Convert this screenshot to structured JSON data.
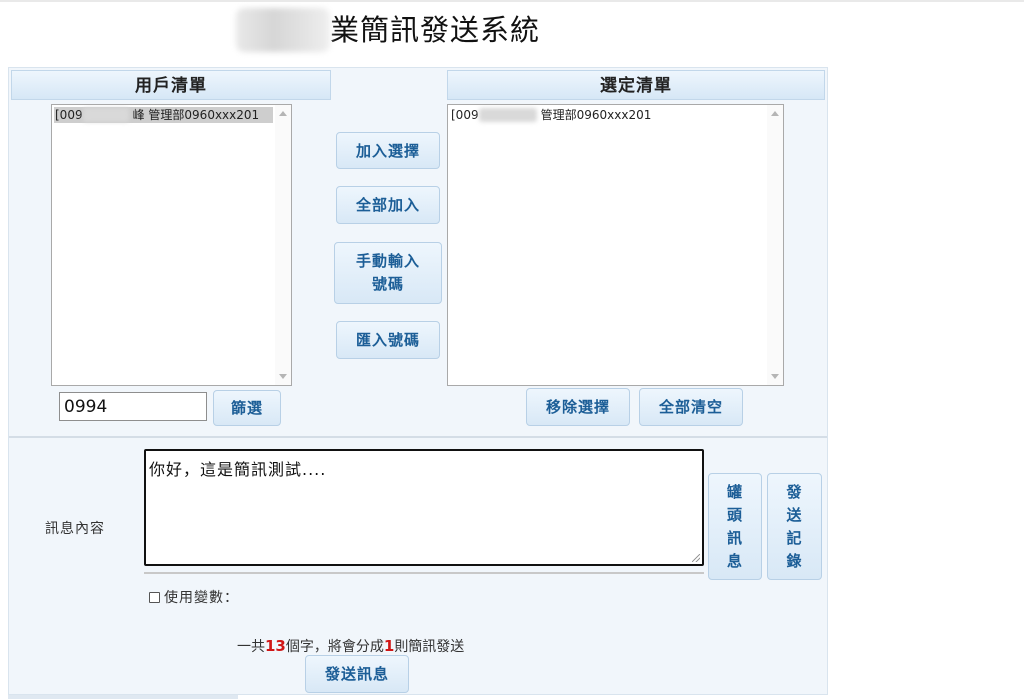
{
  "page": {
    "title_suffix": "業簡訊發送系統"
  },
  "left_list": {
    "header": "用戶清單",
    "items": [
      {
        "prefix": "[009",
        "suffix": "峰 管理部0960xxx201",
        "selected": true
      }
    ],
    "filter_value": "0994",
    "filter_button": "篩選"
  },
  "middle_buttons": {
    "add_selected": "加入選擇",
    "add_all": "全部加入",
    "manual_line1": "手動輸入",
    "manual_line2": "號碼",
    "import": "匯入號碼"
  },
  "right_list": {
    "header": "選定清單",
    "items": [
      {
        "prefix": "[009",
        "suffix": "管理部0960xxx201"
      }
    ],
    "remove_button": "移除選擇",
    "clear_button": "全部清空"
  },
  "message": {
    "label": "訊息內容",
    "content": "你好，這是簡訊測試....",
    "use_variables_label": "使用變數：",
    "use_variables_checked": false,
    "canned_button": [
      "罐",
      "頭",
      "訊",
      "息"
    ],
    "history_button": [
      "發",
      "送",
      "記",
      "錄"
    ],
    "count": {
      "pre": "一共",
      "chars": "13",
      "mid": "個字，將會分成",
      "msgs": "1",
      "post": "則簡訊發送"
    },
    "send_button": "發送訊息"
  },
  "colors": {
    "button_text": "#1c5e97",
    "count_highlight": "#d01616",
    "panel_bg": "#f1f6fb"
  }
}
